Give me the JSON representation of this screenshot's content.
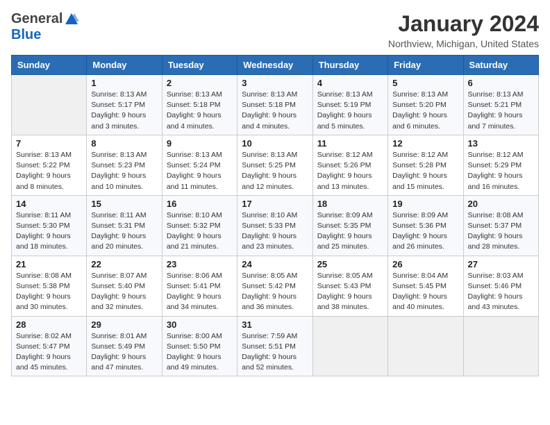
{
  "header": {
    "logo_general": "General",
    "logo_blue": "Blue",
    "title": "January 2024",
    "subtitle": "Northview, Michigan, United States"
  },
  "weekdays": [
    "Sunday",
    "Monday",
    "Tuesday",
    "Wednesday",
    "Thursday",
    "Friday",
    "Saturday"
  ],
  "weeks": [
    [
      {
        "day": "",
        "detail": ""
      },
      {
        "day": "1",
        "detail": "Sunrise: 8:13 AM\nSunset: 5:17 PM\nDaylight: 9 hours\nand 3 minutes."
      },
      {
        "day": "2",
        "detail": "Sunrise: 8:13 AM\nSunset: 5:18 PM\nDaylight: 9 hours\nand 4 minutes."
      },
      {
        "day": "3",
        "detail": "Sunrise: 8:13 AM\nSunset: 5:18 PM\nDaylight: 9 hours\nand 4 minutes."
      },
      {
        "day": "4",
        "detail": "Sunrise: 8:13 AM\nSunset: 5:19 PM\nDaylight: 9 hours\nand 5 minutes."
      },
      {
        "day": "5",
        "detail": "Sunrise: 8:13 AM\nSunset: 5:20 PM\nDaylight: 9 hours\nand 6 minutes."
      },
      {
        "day": "6",
        "detail": "Sunrise: 8:13 AM\nSunset: 5:21 PM\nDaylight: 9 hours\nand 7 minutes."
      }
    ],
    [
      {
        "day": "7",
        "detail": "Sunrise: 8:13 AM\nSunset: 5:22 PM\nDaylight: 9 hours\nand 8 minutes."
      },
      {
        "day": "8",
        "detail": "Sunrise: 8:13 AM\nSunset: 5:23 PM\nDaylight: 9 hours\nand 10 minutes."
      },
      {
        "day": "9",
        "detail": "Sunrise: 8:13 AM\nSunset: 5:24 PM\nDaylight: 9 hours\nand 11 minutes."
      },
      {
        "day": "10",
        "detail": "Sunrise: 8:13 AM\nSunset: 5:25 PM\nDaylight: 9 hours\nand 12 minutes."
      },
      {
        "day": "11",
        "detail": "Sunrise: 8:12 AM\nSunset: 5:26 PM\nDaylight: 9 hours\nand 13 minutes."
      },
      {
        "day": "12",
        "detail": "Sunrise: 8:12 AM\nSunset: 5:28 PM\nDaylight: 9 hours\nand 15 minutes."
      },
      {
        "day": "13",
        "detail": "Sunrise: 8:12 AM\nSunset: 5:29 PM\nDaylight: 9 hours\nand 16 minutes."
      }
    ],
    [
      {
        "day": "14",
        "detail": "Sunrise: 8:11 AM\nSunset: 5:30 PM\nDaylight: 9 hours\nand 18 minutes."
      },
      {
        "day": "15",
        "detail": "Sunrise: 8:11 AM\nSunset: 5:31 PM\nDaylight: 9 hours\nand 20 minutes."
      },
      {
        "day": "16",
        "detail": "Sunrise: 8:10 AM\nSunset: 5:32 PM\nDaylight: 9 hours\nand 21 minutes."
      },
      {
        "day": "17",
        "detail": "Sunrise: 8:10 AM\nSunset: 5:33 PM\nDaylight: 9 hours\nand 23 minutes."
      },
      {
        "day": "18",
        "detail": "Sunrise: 8:09 AM\nSunset: 5:35 PM\nDaylight: 9 hours\nand 25 minutes."
      },
      {
        "day": "19",
        "detail": "Sunrise: 8:09 AM\nSunset: 5:36 PM\nDaylight: 9 hours\nand 26 minutes."
      },
      {
        "day": "20",
        "detail": "Sunrise: 8:08 AM\nSunset: 5:37 PM\nDaylight: 9 hours\nand 28 minutes."
      }
    ],
    [
      {
        "day": "21",
        "detail": "Sunrise: 8:08 AM\nSunset: 5:38 PM\nDaylight: 9 hours\nand 30 minutes."
      },
      {
        "day": "22",
        "detail": "Sunrise: 8:07 AM\nSunset: 5:40 PM\nDaylight: 9 hours\nand 32 minutes."
      },
      {
        "day": "23",
        "detail": "Sunrise: 8:06 AM\nSunset: 5:41 PM\nDaylight: 9 hours\nand 34 minutes."
      },
      {
        "day": "24",
        "detail": "Sunrise: 8:05 AM\nSunset: 5:42 PM\nDaylight: 9 hours\nand 36 minutes."
      },
      {
        "day": "25",
        "detail": "Sunrise: 8:05 AM\nSunset: 5:43 PM\nDaylight: 9 hours\nand 38 minutes."
      },
      {
        "day": "26",
        "detail": "Sunrise: 8:04 AM\nSunset: 5:45 PM\nDaylight: 9 hours\nand 40 minutes."
      },
      {
        "day": "27",
        "detail": "Sunrise: 8:03 AM\nSunset: 5:46 PM\nDaylight: 9 hours\nand 43 minutes."
      }
    ],
    [
      {
        "day": "28",
        "detail": "Sunrise: 8:02 AM\nSunset: 5:47 PM\nDaylight: 9 hours\nand 45 minutes."
      },
      {
        "day": "29",
        "detail": "Sunrise: 8:01 AM\nSunset: 5:49 PM\nDaylight: 9 hours\nand 47 minutes."
      },
      {
        "day": "30",
        "detail": "Sunrise: 8:00 AM\nSunset: 5:50 PM\nDaylight: 9 hours\nand 49 minutes."
      },
      {
        "day": "31",
        "detail": "Sunrise: 7:59 AM\nSunset: 5:51 PM\nDaylight: 9 hours\nand 52 minutes."
      },
      {
        "day": "",
        "detail": ""
      },
      {
        "day": "",
        "detail": ""
      },
      {
        "day": "",
        "detail": ""
      }
    ]
  ]
}
